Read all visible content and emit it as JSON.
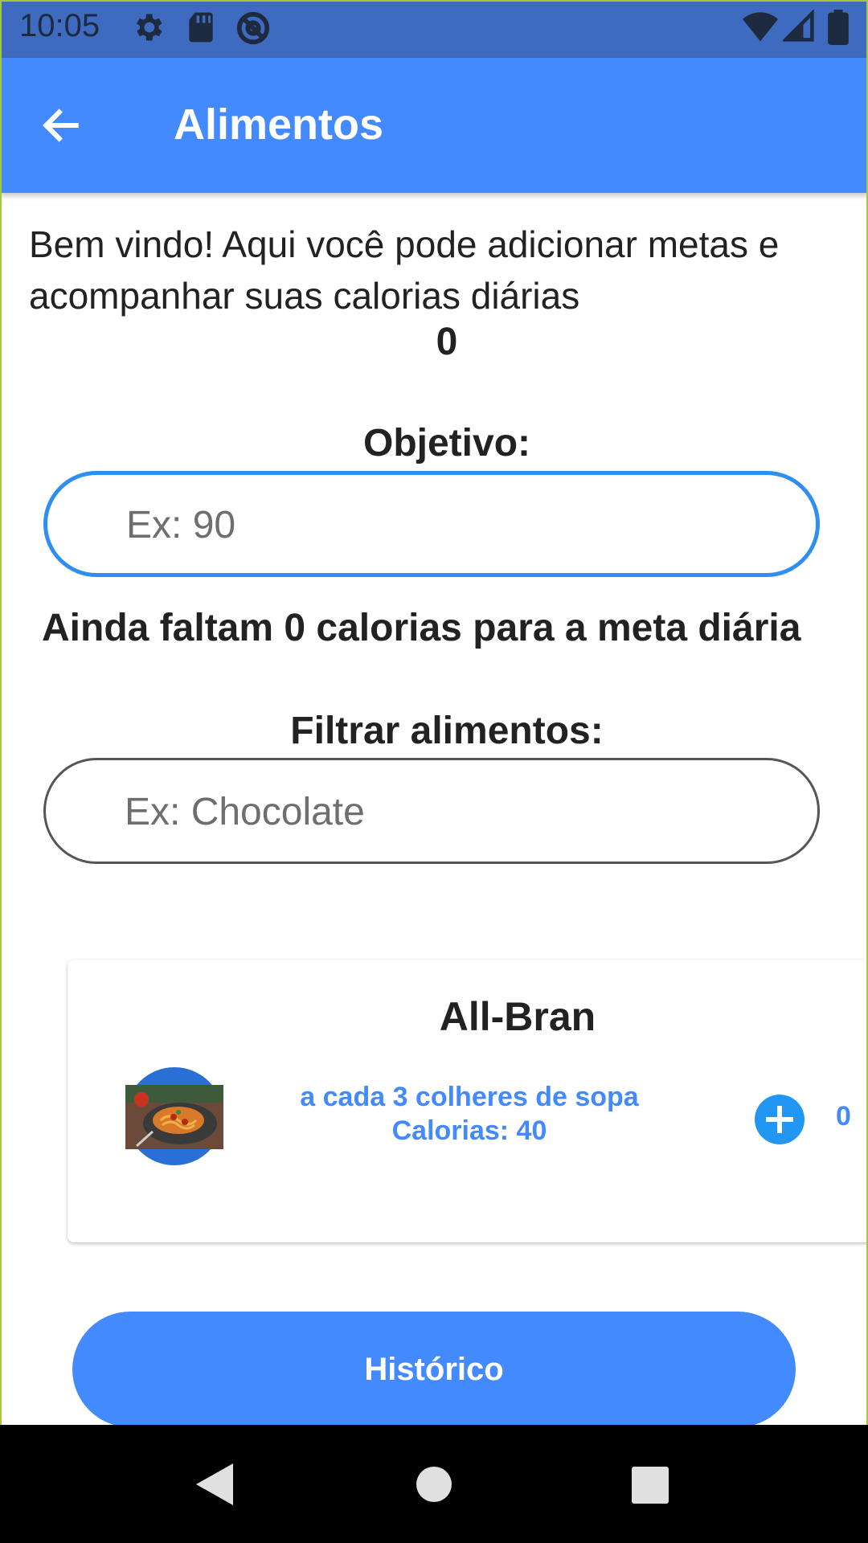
{
  "status_bar": {
    "time": "10:05",
    "icons": [
      "settings-icon",
      "sd-card-icon",
      "at-sign-icon",
      "wifi-icon",
      "signal-icon",
      "battery-icon"
    ]
  },
  "app_bar": {
    "title": "Alimentos",
    "back_icon": "arrow-left-icon",
    "color": "#448aff"
  },
  "intro": {
    "text": "Bem vindo! Aqui você pode adicionar metas e acompanhar suas calorias diárias",
    "total_calories": "0"
  },
  "goal": {
    "label": "Objetivo:",
    "placeholder": "Ex: 90",
    "value": ""
  },
  "remaining_text": "Ainda faltam 0 calorias para a meta diária",
  "filter": {
    "label": "Filtrar alimentos:",
    "placeholder": "Ex: Chocolate",
    "value": ""
  },
  "food_items": [
    {
      "name": "All-Bran",
      "portion": "a cada 3 colheres de sopa",
      "calories": "Calorias: 40",
      "quantity": "0",
      "add_icon": "plus-circle-icon"
    }
  ],
  "history_button": "Histórico",
  "nav_bar": {
    "icons": [
      "back-triangle-icon",
      "home-circle-icon",
      "recents-square-icon"
    ]
  },
  "colors": {
    "primary": "#448aff",
    "status_bar": "#3e6bbf",
    "goal_input_border": "#2f8ff0",
    "add_button": "#2196f3"
  }
}
